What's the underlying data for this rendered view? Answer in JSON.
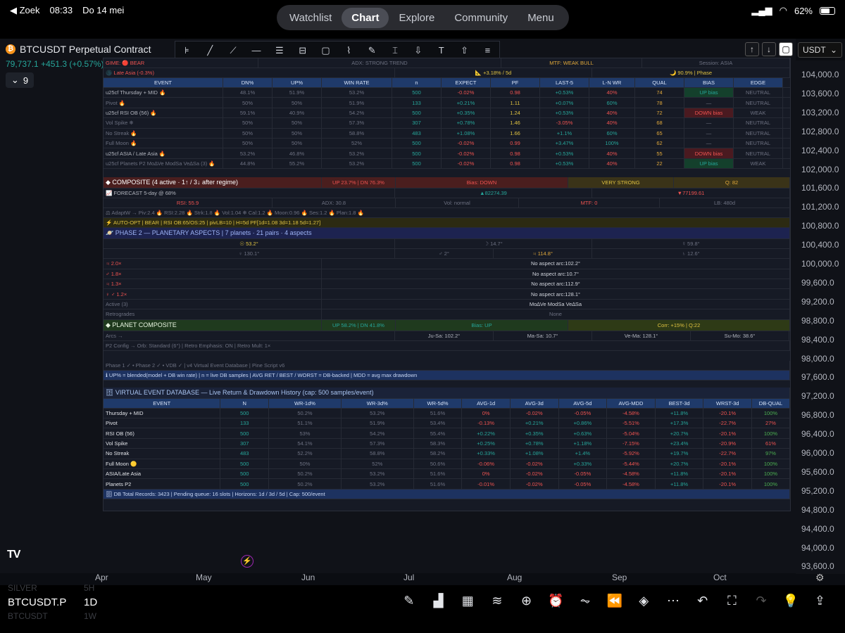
{
  "status_bar": {
    "search": "Zoek",
    "time": "08:33",
    "date": "Do 14 mei",
    "battery": "62%"
  },
  "nav_tabs": [
    "Watchlist",
    "Chart",
    "Explore",
    "Community",
    "Menu"
  ],
  "nav_active": "Chart",
  "symbol": {
    "title": "BTCUSDT Perpetual Contract",
    "price": "79,737.1",
    "change": "+451.3 (+0.57%)",
    "collapse_count": "9",
    "currency": "USDT"
  },
  "price_axis": [
    "104,000.0",
    "103,600.0",
    "103,200.0",
    "102,800.0",
    "102,400.0",
    "102,000.0",
    "101,600.0",
    "101,200.0",
    "100,800.0",
    "100,400.0",
    "100,000.0",
    "99,600.0",
    "99,200.0",
    "98,800.0",
    "98,400.0",
    "98,000.0",
    "97,600.0",
    "97,200.0",
    "96,800.0",
    "96,400.0",
    "96,000.0",
    "95,600.0",
    "95,200.0",
    "94,800.0",
    "94,400.0",
    "94,000.0",
    "93,600.0"
  ],
  "date_axis": [
    "Apr",
    "May",
    "Jun",
    "Jul",
    "Aug",
    "Sep",
    "Oct"
  ],
  "bottom": {
    "symbol": "BTCUSDT.P",
    "interval": "1D",
    "ghost_top": "SILVER",
    "ghost_top_tf": "5H",
    "ghost_bottom": "BTCUSDT",
    "ghost_bottom_tf": "1W"
  },
  "table": {
    "top_row": {
      "regime": "GIME: 🔴 BEAR",
      "adx": "ADX: STRONG TREND",
      "mtf": "MTF: WEAK BULL",
      "session": "Session: ASIA"
    },
    "second_row": {
      "session": "🌑 Late Asia  (-0.3%)",
      "trend": "📐 +3.18% / 5d",
      "moon": "🌙 90.9% | Phase"
    },
    "event_headers": [
      "EVENT",
      "DN%",
      "UP%",
      "WIN RATE",
      "n",
      "EXPECT",
      "PF",
      "LAST-5",
      "L-N WR",
      "QUAL",
      "BIAS",
      "EDGE"
    ],
    "events": [
      [
        "u25cf Thursday + MID 🔥",
        "48.1%",
        "51.9%",
        "53.2%",
        "500",
        "-0.02%",
        "0.98",
        "+0.53%",
        "40%",
        "74",
        "UP bias",
        "NEUTRAL"
      ],
      [
        "Pivot 🔥",
        "50%",
        "50%",
        "51.9%",
        "133",
        "+0.21%",
        "1.11",
        "+0.07%",
        "60%",
        "78",
        "—",
        "NEUTRAL"
      ],
      [
        "u25cf RSI OB (56) 🔥",
        "59.1%",
        "40.9%",
        "54.2%",
        "500",
        "+0.35%",
        "1.24",
        "+0.53%",
        "40%",
        "72",
        "DOWN bias",
        "WEAK"
      ],
      [
        "Vol Spike ❄",
        "50%",
        "50%",
        "57.3%",
        "307",
        "+0.78%",
        "1.46",
        "-3.05%",
        "40%",
        "68",
        "—",
        "NEUTRAL"
      ],
      [
        "No Streak 🔥",
        "50%",
        "50%",
        "58.8%",
        "483",
        "+1.08%",
        "1.66",
        "+1.1%",
        "60%",
        "65",
        "—",
        "NEUTRAL"
      ],
      [
        "Full Moon 🔥",
        "50%",
        "50%",
        "52%",
        "500",
        "-0.02%",
        "0.99",
        "+3.47%",
        "100%",
        "62",
        "—",
        "NEUTRAL"
      ],
      [
        "u25cf ASIA / Late Asia 🔥",
        "53.2%",
        "46.8%",
        "53.2%",
        "500",
        "-0.02%",
        "0.98",
        "+0.53%",
        "40%",
        "55",
        "DOWN bias",
        "NEUTRAL"
      ],
      [
        "u25cf Planets P2 Mo∆Ve ModSa Ve∆Sa (3) 🔥",
        "44.8%",
        "55.2%",
        "53.2%",
        "500",
        "-0.02%",
        "0.98",
        "+0.53%",
        "40%",
        "22",
        "UP bias",
        "WEAK"
      ]
    ],
    "composite": {
      "label": "◆ COMPOSITE  (4 active · 1↑ / 3↓ after regime)",
      "updn": "UP 23.7%  |  DN 76.3%",
      "bias": "Bias: DOWN",
      "strength": "VERY STRONG",
      "q": "Q: 82"
    },
    "forecast": {
      "label": "📈 FORECAST  5-day @ 68%",
      "up": "▲82274.39",
      "down": "▼77199.61"
    },
    "stats_row": {
      "rsi": "RSI: 55.9",
      "adx": "ADX: 30.8",
      "vol": "Vol: normal",
      "mtf": "MTF: 0",
      "lb": "LB: 480d"
    },
    "weights": "⚖ AdaptW → Piv:2.4 🔥  RSI:2.28 🔥  Strk:1.8 🔥  Vol:1.04 ❄  Cal:1.2 🔥  Moon:0.96 🔥  Ses:1.2 🔥  Plan:1.8 🔥",
    "auto_opt": "⚡ AUTO-OPT | BEAR | RSI OB:65/OS:25  |  pivLB=10  |  H=5d PF[1d=1.08 3d=1.18 5d=1.27]",
    "phase2": {
      "label": "🪐 PHASE 2 — PLANETARY ASPECTS  |  7 planets · 21 pairs · 4 aspects",
      "p1": "☉ 53.2°",
      "p2": "☽ 14.7°",
      "p3": "☿ 59.8°",
      "p4": "♀ 130.1°",
      "p5": "♂ 2°",
      "p6": "♃ 114.8°",
      "p7": "♄ 12.6°"
    },
    "aspects": [
      [
        "♃ 2.0×",
        "No aspect  arc:102.2°"
      ],
      [
        "♂ 1.8×",
        "No aspect  arc:10.7°"
      ],
      [
        "♃ 1.3×",
        "No aspect  arc:112.9°"
      ],
      [
        "♀ ♂ 1.2×",
        "No aspect  arc:128.1°"
      ],
      [
        "Active (3)",
        "Mo∆Ve ModSa Ve∆Sa"
      ],
      [
        "Retrogrades",
        "None"
      ]
    ],
    "planet_comp": {
      "label": "◆ PLANET COMPOSITE",
      "updn": "UP 58.2%  |  DN 41.8%",
      "bias": "Bias: UP",
      "corr": "Corr: +15% | Q:22"
    },
    "arcs": {
      "label": "Arcs →",
      "a1": "Ju-Sa: 102.2°",
      "a2": "Ma-Sa: 10.7°",
      "a3": "Ve-Ma: 128.1°",
      "a4": "Su-Mo: 38.6°"
    },
    "p2config": "P2 Config → Orb: Standard (6°)  |  Retro Emphasis: ON  |  Retro Mult: 1×",
    "phase_line": "Phase 1 ✓ • Phase 2 ✓ • VDB ✓  |  v4 Virtual Event Database  |  Pine Script v6",
    "info_line": "ℹ UP% = blended(model + DB win rate)  |  n = live DB samples  |  AVG RET / BEST / WORST = DB-backed  |  MDD = avg max drawdown",
    "vdb_label": "🗄 VIRTUAL EVENT DATABASE  —  Live Return & Drawdown History  (cap: 500 samples/event)",
    "vdb_headers": [
      "EVENT",
      "N",
      "WR-1d%",
      "WR-3d%",
      "WR-5d%",
      "AVG-1d",
      "AVG-3d",
      "AVG-5d",
      "AVG-MDD",
      "BEST-3d",
      "WRST-3d",
      "DB-QUAL"
    ],
    "vdb": [
      [
        "Thursday + MID",
        "500",
        "50.2%",
        "53.2%",
        "51.6%",
        "0%",
        "-0.02%",
        "-0.05%",
        "-4.58%",
        "+11.8%",
        "-20.1%",
        "100%"
      ],
      [
        "Pivot",
        "133",
        "51.1%",
        "51.9%",
        "53.4%",
        "-0.13%",
        "+0.21%",
        "+0.86%",
        "-5.51%",
        "+17.3%",
        "-22.7%",
        "27%"
      ],
      [
        "RSI OB (56)",
        "500",
        "53%",
        "54.2%",
        "55.4%",
        "+0.22%",
        "+0.35%",
        "+0.63%",
        "-5.04%",
        "+20.7%",
        "-20.1%",
        "100%"
      ],
      [
        "Vol Spike",
        "307",
        "54.1%",
        "57.3%",
        "58.3%",
        "+0.25%",
        "+0.78%",
        "+1.18%",
        "-7.15%",
        "+23.4%",
        "-20.9%",
        "61%"
      ],
      [
        "No Streak",
        "483",
        "52.2%",
        "58.8%",
        "58.2%",
        "+0.33%",
        "+1.08%",
        "+1.4%",
        "-5.92%",
        "+19.7%",
        "-22.7%",
        "97%"
      ],
      [
        "Full Moon 🟡",
        "500",
        "50%",
        "52%",
        "50.6%",
        "-0.06%",
        "-0.02%",
        "+0.33%",
        "-5.44%",
        "+20.7%",
        "-20.1%",
        "100%"
      ],
      [
        "ASIA/Late Asia",
        "500",
        "50.2%",
        "53.2%",
        "51.6%",
        "0%",
        "-0.02%",
        "-0.05%",
        "-4.58%",
        "+11.8%",
        "-20.1%",
        "100%"
      ],
      [
        "Planets P2",
        "500",
        "50.2%",
        "53.2%",
        "51.6%",
        "-0.01%",
        "-0.02%",
        "-0.05%",
        "-4.58%",
        "+11.8%",
        "-20.1%",
        "100%"
      ]
    ],
    "footer": "🗄 DB Total Records: 3423  |  Pending queue: 16 slots  |  Horizons: 1d / 3d / 5d  |  Cap: 500/event"
  }
}
